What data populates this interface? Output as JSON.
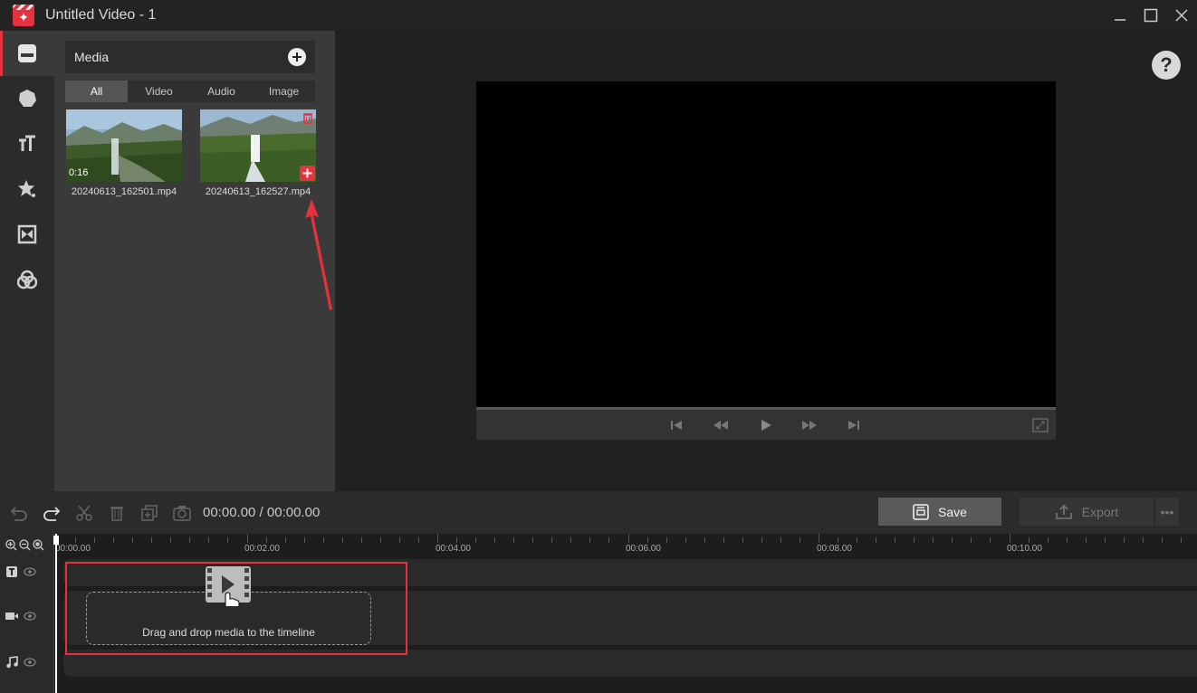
{
  "window": {
    "title": "Untitled Video - 1"
  },
  "sidebar": {
    "items": [
      {
        "name": "media",
        "icon": "media-icon",
        "active": true
      },
      {
        "name": "elements",
        "icon": "shape-icon"
      },
      {
        "name": "text",
        "icon": "text-icon"
      },
      {
        "name": "effects",
        "icon": "effects-star-icon"
      },
      {
        "name": "transitions",
        "icon": "transition-icon"
      },
      {
        "name": "filters",
        "icon": "filter-icon"
      }
    ]
  },
  "media_panel": {
    "header": "Media",
    "tabs": [
      "All",
      "Video",
      "Audio",
      "Image"
    ],
    "active_tab": "All",
    "items": [
      {
        "filename": "20240613_162501.mp4",
        "duration": "0:16"
      },
      {
        "filename": "20240613_162527.mp4",
        "duration": ""
      }
    ]
  },
  "toolbar": {
    "timecode": "00:00.00 / 00:00.00",
    "save_label": "Save",
    "export_label": "Export",
    "more_label": "•••"
  },
  "timeline": {
    "ruler_labels": [
      "00:00.00",
      "00:02.00",
      "00:04.00",
      "00:06.00",
      "00:08.00",
      "00:10.00"
    ],
    "drop_hint": "Drag and drop media to the timeline"
  },
  "colors": {
    "accent": "#e8313f",
    "panel": "#3a3a3a",
    "background": "#212121"
  }
}
